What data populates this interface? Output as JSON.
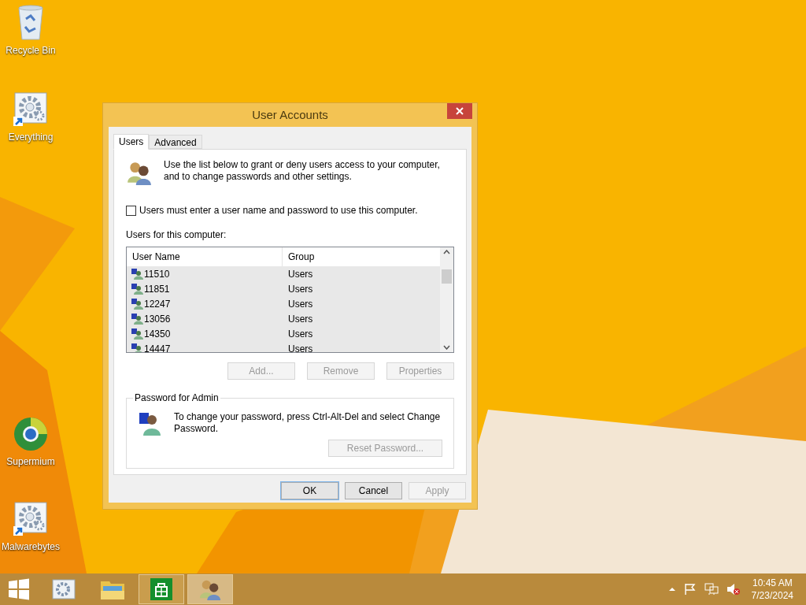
{
  "desktop_icons": [
    {
      "label": "Recycle Bin",
      "kind": "recycle"
    },
    {
      "label": "Everything",
      "kind": "gear"
    },
    {
      "label": "Supermium",
      "kind": "browser"
    },
    {
      "label": "Malwarebytes",
      "kind": "gear"
    }
  ],
  "dialog": {
    "title": "User Accounts",
    "tabs": [
      {
        "label": "Users",
        "selected": true
      },
      {
        "label": "Advanced",
        "selected": false
      }
    ],
    "intro": "Use the list below to grant or deny users access to your computer, and to change passwords and other settings.",
    "checkbox": {
      "label": "Users must enter a user name and password to use this computer.",
      "checked": false
    },
    "list_label": "Users for this computer:",
    "table": {
      "columns": [
        "User Name",
        "Group"
      ],
      "rows": [
        {
          "user_name": "11510",
          "group": "Users"
        },
        {
          "user_name": "11851",
          "group": "Users"
        },
        {
          "user_name": "12247",
          "group": "Users"
        },
        {
          "user_name": "13056",
          "group": "Users"
        },
        {
          "user_name": "14350",
          "group": "Users"
        },
        {
          "user_name": "14447",
          "group": "Users"
        }
      ]
    },
    "list_buttons": [
      {
        "label": "Add...",
        "disabled": true
      },
      {
        "label": "Remove",
        "disabled": true
      },
      {
        "label": "Properties",
        "disabled": true
      }
    ],
    "password_group": {
      "title": "Password for Admin",
      "text": "To change your password, press Ctrl-Alt-Del and select Change Password.",
      "button": {
        "label": "Reset Password...",
        "disabled": true
      }
    },
    "buttons": [
      {
        "label": "OK",
        "disabled": false,
        "selected": true
      },
      {
        "label": "Cancel",
        "disabled": false,
        "selected": false
      },
      {
        "label": "Apply",
        "disabled": true,
        "selected": false
      }
    ]
  },
  "taskbar": {
    "apps": [
      {
        "kind": "control",
        "running": false,
        "selected": false
      },
      {
        "kind": "folder",
        "running": false,
        "selected": false
      },
      {
        "kind": "store",
        "running": true,
        "selected": false
      },
      {
        "kind": "users",
        "running": true,
        "selected": true
      }
    ],
    "time": "10:45 AM",
    "date": "7/23/2024"
  }
}
